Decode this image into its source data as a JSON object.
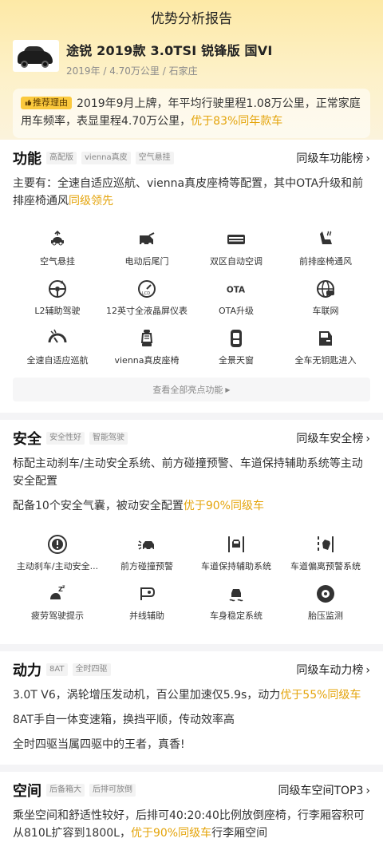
{
  "header": {
    "title": "优势分析报告"
  },
  "car": {
    "name": "途锐 2019款 3.0TSI 锐锋版 国VI",
    "meta": "2019年 / 4.70万公里 / 石家庄",
    "reason_tag": "推荐理由",
    "reason_text": "2019年9月上牌，年平均行驶里程1.08万公里，正常家庭用车频率，表显里程4.70万公里，",
    "reason_highlight": "优于83%同年款车"
  },
  "function": {
    "title": "功能",
    "chips": [
      "高配版",
      "vienna真皮",
      "空气悬挂"
    ],
    "rank_label": "同级车功能榜",
    "desc_text": "主要有：全速自适应巡航、vienna真皮座椅等配置，其中OTA升级和前排座椅通风",
    "desc_highlight": "同级领先",
    "features": [
      {
        "label": "空气悬挂",
        "icon": "air-suspension-icon"
      },
      {
        "label": "电动后尾门",
        "icon": "power-tailgate-icon"
      },
      {
        "label": "双区自动空调",
        "icon": "dual-zone-ac-icon"
      },
      {
        "label": "前排座椅通风",
        "icon": "seat-ventilation-icon"
      },
      {
        "label": "L2辅助驾驶",
        "icon": "l2-assist-icon"
      },
      {
        "label": "12英寸全液晶屏仪表",
        "icon": "lcd-cluster-icon"
      },
      {
        "label": "OTA升级",
        "icon": "ota-icon"
      },
      {
        "label": "车联网",
        "icon": "connected-car-icon"
      },
      {
        "label": "全速自适应巡航",
        "icon": "adaptive-cruise-icon"
      },
      {
        "label": "vienna真皮座椅",
        "icon": "leather-seat-icon"
      },
      {
        "label": "全景天窗",
        "icon": "panoramic-sunroof-icon"
      },
      {
        "label": "全车无钥匙进入",
        "icon": "keyless-entry-icon"
      }
    ],
    "more_label": "查看全部亮点功能"
  },
  "safety": {
    "title": "安全",
    "chips": [
      "安全性好",
      "智能驾驶"
    ],
    "rank_label": "同级车安全榜",
    "desc1": "标配主动刹车/主动安全系统、前方碰撞预警、车道保持辅助系统等主动安全配置",
    "desc2_text": "配备10个安全气囊，被动安全配置",
    "desc2_highlight": "优于90%同级车",
    "features": [
      {
        "label": "主动刹车/主动安全...",
        "icon": "active-brake-icon"
      },
      {
        "label": "前方碰撞预警",
        "icon": "collision-warning-icon"
      },
      {
        "label": "车道保持辅助系统",
        "icon": "lane-keep-icon"
      },
      {
        "label": "车道偏离预警系统",
        "icon": "lane-departure-icon"
      },
      {
        "label": "疲劳驾驶提示",
        "icon": "fatigue-alert-icon"
      },
      {
        "label": "并线辅助",
        "icon": "blind-spot-icon"
      },
      {
        "label": "车身稳定系统",
        "icon": "stability-control-icon"
      },
      {
        "label": "胎压监测",
        "icon": "tire-pressure-icon"
      }
    ]
  },
  "power": {
    "title": "动力",
    "chips": [
      "8AT",
      "全时四驱"
    ],
    "rank_label": "同级车动力榜",
    "desc1_text": "3.0T V6，涡轮增压发动机，百公里加速仅5.9s，动力",
    "desc1_highlight": "优于55%同级车",
    "desc2": "8AT手自一体变速箱，换挡平顺，传动效率高",
    "desc3": "全时四驱当属四驱中的王者，真香!"
  },
  "space": {
    "title": "空间",
    "chips": [
      "后备箱大",
      "后排可放倒"
    ],
    "rank_label": "同级车空间TOP3",
    "desc_text": "乘坐空间和舒适性较好，后排可40:20:40比例放倒座椅，行李厢容积可从810L扩容到1800L，",
    "desc_highlight": "优于90%同级车",
    "desc_tail": "行李厢空间"
  },
  "colors": {
    "accent": "#e4a40b",
    "tag": "#fbc93d",
    "hero_top": "#fde9a6"
  }
}
